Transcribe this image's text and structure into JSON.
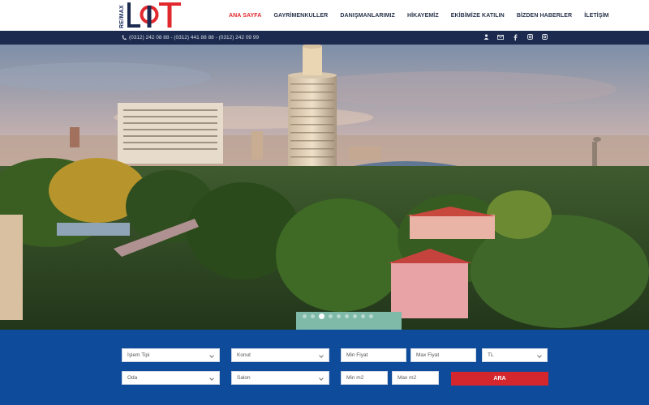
{
  "brand": {
    "name": "RE/MAX",
    "colors": {
      "navy": "#1b2a4e",
      "red": "#e0282d",
      "blue": "#0e4b9a"
    }
  },
  "nav": [
    {
      "label": "ANA SAYFA",
      "active": true
    },
    {
      "label": "GAYRİMENKULLER",
      "active": false
    },
    {
      "label": "DANIŞMANLARIMIZ",
      "active": false
    },
    {
      "label": "HİKAYEMİZ",
      "active": false
    },
    {
      "label": "EKİBİMİZE KATILIN",
      "active": false
    },
    {
      "label": "BİZDEN HABERLER",
      "active": false
    },
    {
      "label": "İLETİŞİM",
      "active": false
    }
  ],
  "topbar": {
    "phones": "(0312) 242 08 88 - (0312) 441 88 88 - (0312) 242 09 99",
    "social_icons": [
      "user-icon",
      "mail-icon",
      "facebook-icon",
      "instagram-icon",
      "instagram-icon"
    ]
  },
  "slider": {
    "dot_count": 9,
    "active_index": 2
  },
  "search": {
    "islem_tipi": "İşlem Tipi",
    "konut": "Konut",
    "min_fiyat": "Min Fiyat",
    "max_fiyat": "Max Fiyat",
    "currency": "TL",
    "oda": "Oda",
    "salon": "Salon",
    "min_m2": "Min m2",
    "max_m2": "Max m2",
    "button": "ARA"
  }
}
